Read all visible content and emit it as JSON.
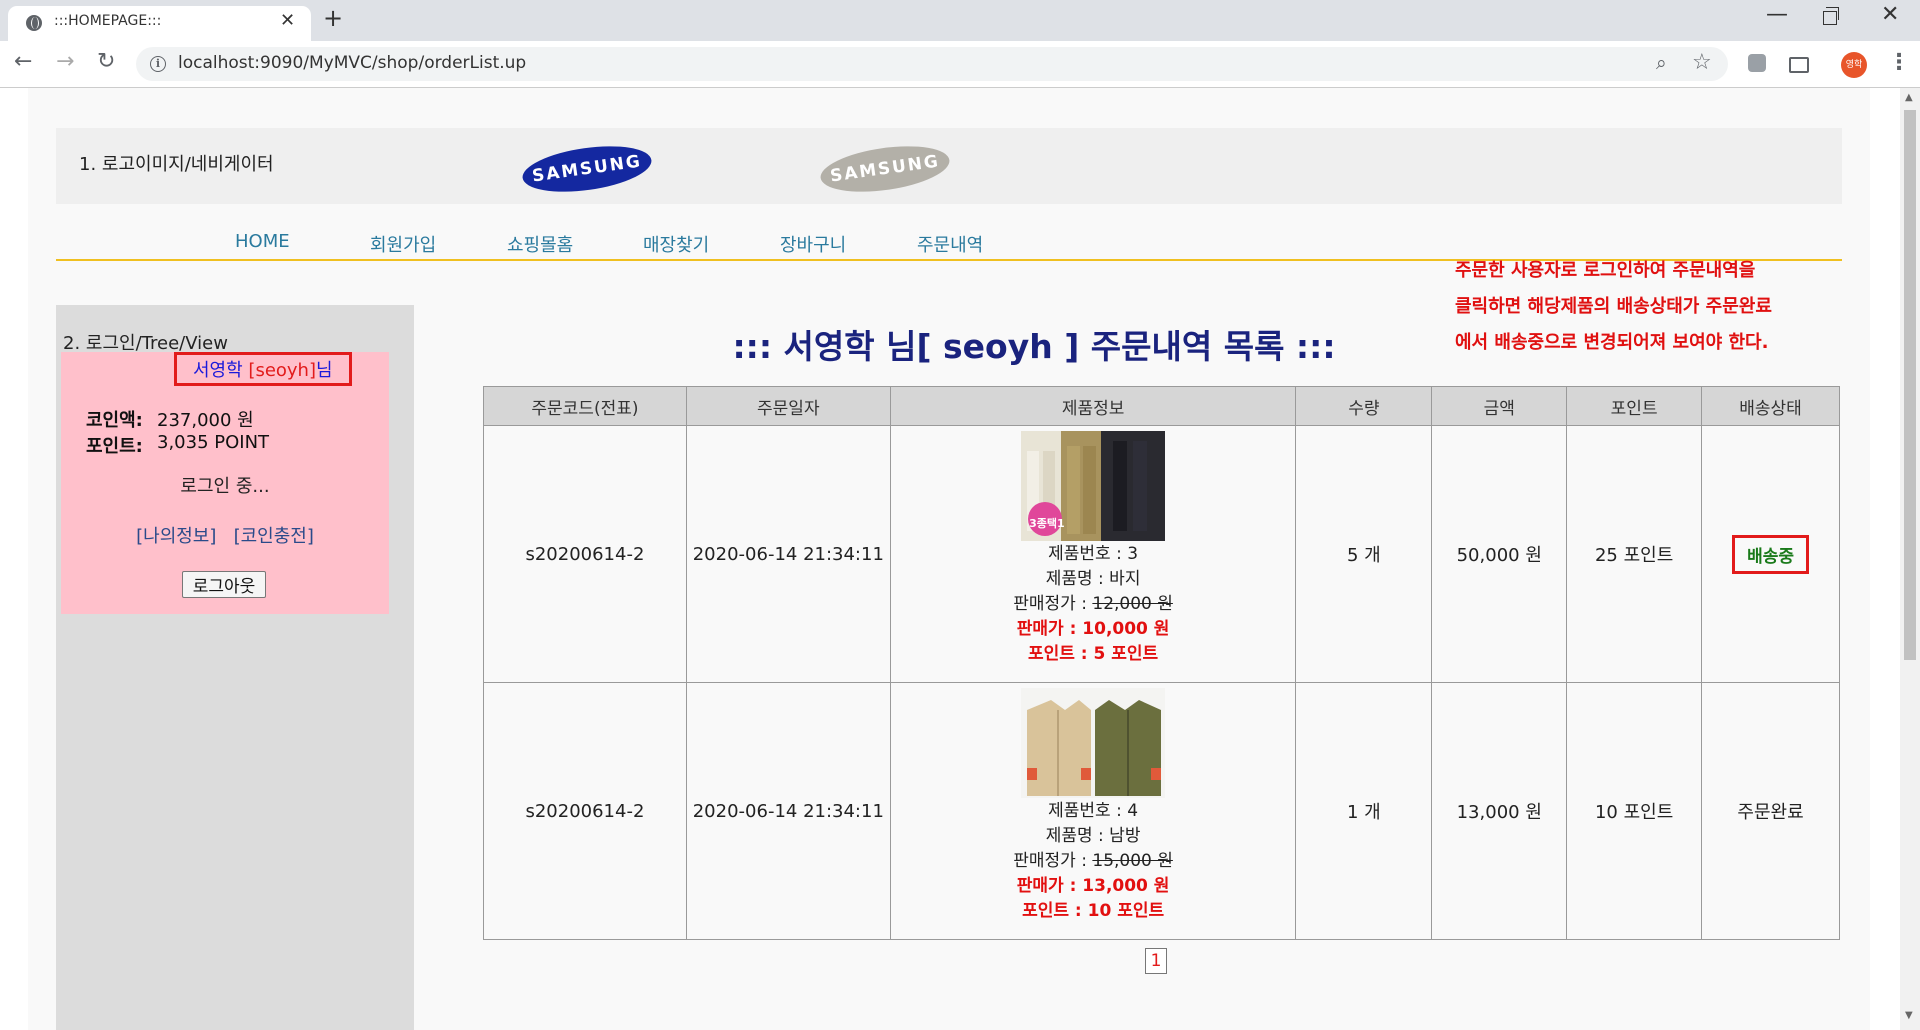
{
  "browser": {
    "tab_title": ":::HOMEPAGE:::",
    "url": "localhost:9090/MyMVC/shop/orderList.up",
    "profile_label": "영학"
  },
  "header": {
    "title": "1. 로고이미지/네비게이터",
    "logo1_text": "SAMSUNG",
    "logo2_text": "SAMSUNG"
  },
  "nav": [
    "HOME",
    "회원가입",
    "쇼핑몰홈",
    "매장찾기",
    "장바구니",
    "주문내역"
  ],
  "notice": "주문한 사용자로 로그인하여 주문내역을\n클릭하면 해당제품의 배송상태가 주문완료\n에서 배송중으로 변경되어져 보여야 한다.",
  "sidebar": {
    "title": "2. 로그인/Tree/View",
    "user_name": "서영학",
    "user_id": "[seoyh]",
    "user_suffix": "님",
    "coin_label": "코인액:",
    "coin_value": "237,000 원",
    "point_label": "포인트:",
    "point_value": "3,035 POINT",
    "status": "로그인 중...",
    "link_myinfo": "[나의정보]",
    "link_charge": "[코인충전]",
    "logout_label": "로그아웃"
  },
  "main": {
    "title": "::: 서영학 님[ seoyh ] 주문내역 목록 :::",
    "columns": [
      "주문코드(전표)",
      "주문일자",
      "제품정보",
      "수량",
      "금액",
      "포인트",
      "배송상태"
    ],
    "orders": [
      {
        "code": "s20200614-2",
        "date": "2020-06-14 21:34:11",
        "prod_no": "제품번호 : 3",
        "prod_name": "제품명 : 바지",
        "list_price_label": "판매정가 : ",
        "list_price": "12,000 원",
        "sale_price": "판매가 : 10,000 원",
        "point_line": "포인트 : 5 포인트",
        "qty": "5 개",
        "amount": "50,000 원",
        "points": "25 포인트",
        "status": "배송중",
        "img_badge": "3종택1"
      },
      {
        "code": "s20200614-2",
        "date": "2020-06-14 21:34:11",
        "prod_no": "제품번호 : 4",
        "prod_name": "제품명 : 남방",
        "list_price_label": "판매정가 : ",
        "list_price": "15,000 원",
        "sale_price": "판매가 : 13,000 원",
        "point_line": "포인트 : 10 포인트",
        "qty": "1 개",
        "amount": "13,000 원",
        "points": "10 포인트",
        "status": "주문완료"
      }
    ],
    "page_number": "1"
  },
  "colors": {
    "accent_blue": "#1a237e",
    "highlight_red": "#e21b1b",
    "nav_link": "#2a7a9e",
    "login_box_bg": "#ffc0cb"
  }
}
